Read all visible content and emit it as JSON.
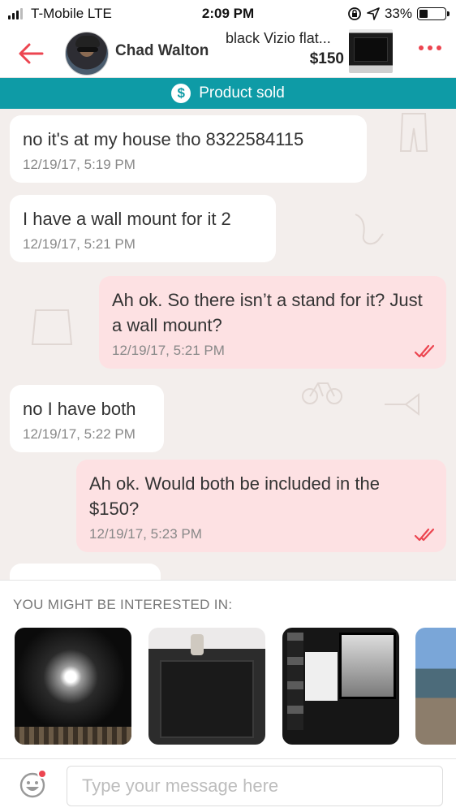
{
  "status_bar": {
    "carrier": "T-Mobile  LTE",
    "time": "2:09 PM",
    "battery": "33%",
    "battery_level": 0.33
  },
  "header": {
    "user_name": "Chad Walton",
    "product_title": "black Vizio flat...",
    "product_price": "$150"
  },
  "banner": {
    "label": "Product sold"
  },
  "messages": [
    {
      "text": "no it's at my house tho 8322584115",
      "time": "12/19/17, 5:19 PM",
      "direction": "in"
    },
    {
      "text": "I have a wall mount for it 2",
      "time": "12/19/17, 5:21 PM",
      "direction": "in"
    },
    {
      "text": "Ah ok. So there isn’t a stand for it? Just a wall mount?",
      "time": "12/19/17, 5:21 PM",
      "direction": "out"
    },
    {
      "text": "no I have both",
      "time": "12/19/17, 5:22 PM",
      "direction": "in"
    },
    {
      "text": "Ah ok. Would both be included in the $150?",
      "time": "12/19/17, 5:23 PM",
      "direction": "out"
    }
  ],
  "suggestions": {
    "title": "YOU MIGHT BE INTERESTED IN:"
  },
  "input": {
    "placeholder": "Type your message here"
  },
  "colors": {
    "accent": "#ec4550",
    "banner": "#0e9ba6",
    "outgoing_bubble": "#fde1e3",
    "incoming_bubble": "#ffffff",
    "chat_background": "#f3eeec"
  }
}
